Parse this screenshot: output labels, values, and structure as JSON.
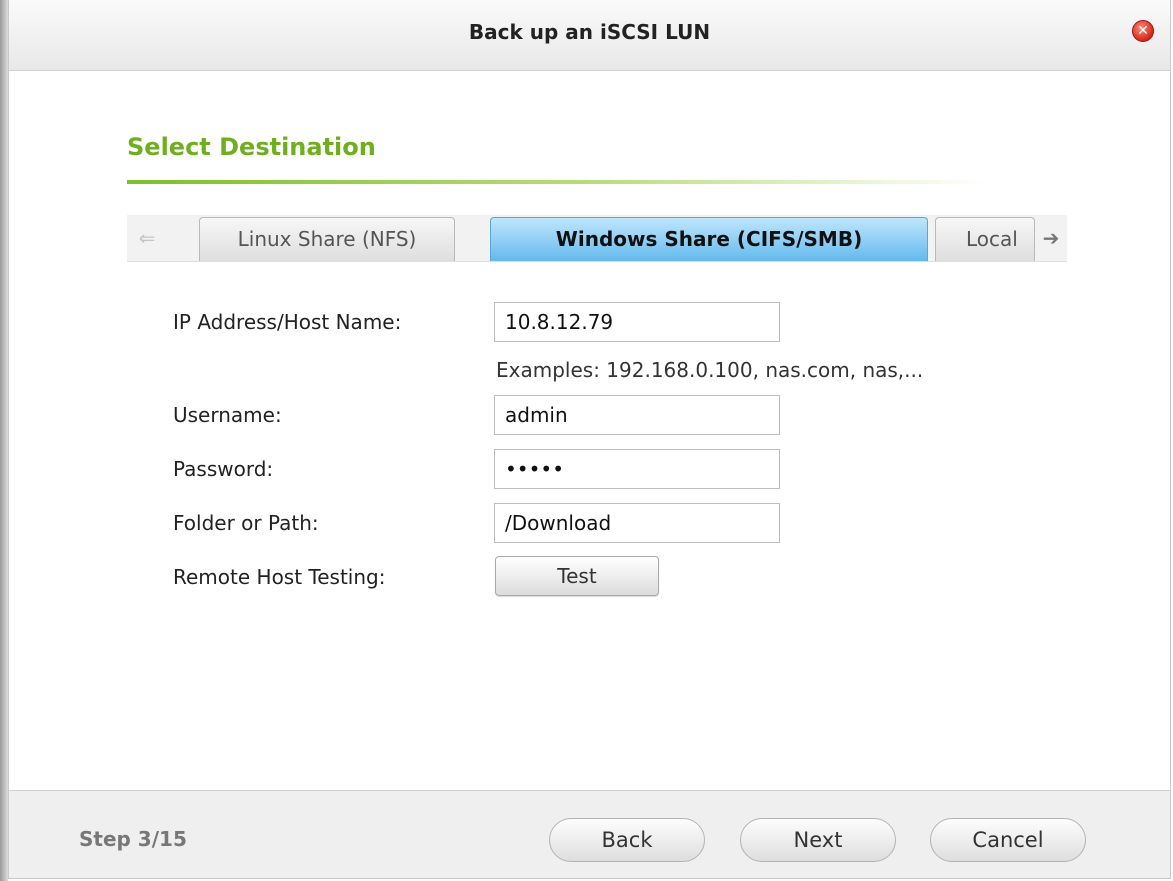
{
  "dialog": {
    "title": "Back up an iSCSI LUN",
    "close_icon_glyph": "✕"
  },
  "section": {
    "title": "Select Destination"
  },
  "tabs": {
    "left_arrow_glyph": "⇐",
    "right_arrow_glyph": "➔",
    "items": [
      {
        "label": "Linux Share (NFS)",
        "active": false
      },
      {
        "label": "Windows Share (CIFS/SMB)",
        "active": true
      },
      {
        "label": "Local",
        "active": false
      }
    ]
  },
  "form": {
    "ip_label": "IP Address/Host Name:",
    "ip_value": "10.8.12.79",
    "ip_hint": "Examples: 192.168.0.100, nas.com, nas,...",
    "username_label": "Username:",
    "username_value": "admin",
    "password_label": "Password:",
    "password_value": "•••••",
    "folder_label": "Folder or Path:",
    "folder_value": "/Download",
    "remote_test_label": "Remote Host Testing:",
    "test_button": "Test"
  },
  "footer": {
    "step": "Step 3/15",
    "back_button": "Back",
    "next_button": "Next",
    "cancel_button": "Cancel"
  },
  "colors": {
    "accent_green": "#6fae1e",
    "active_tab_blue": "#64b9ee",
    "close_red": "#d4281b"
  }
}
